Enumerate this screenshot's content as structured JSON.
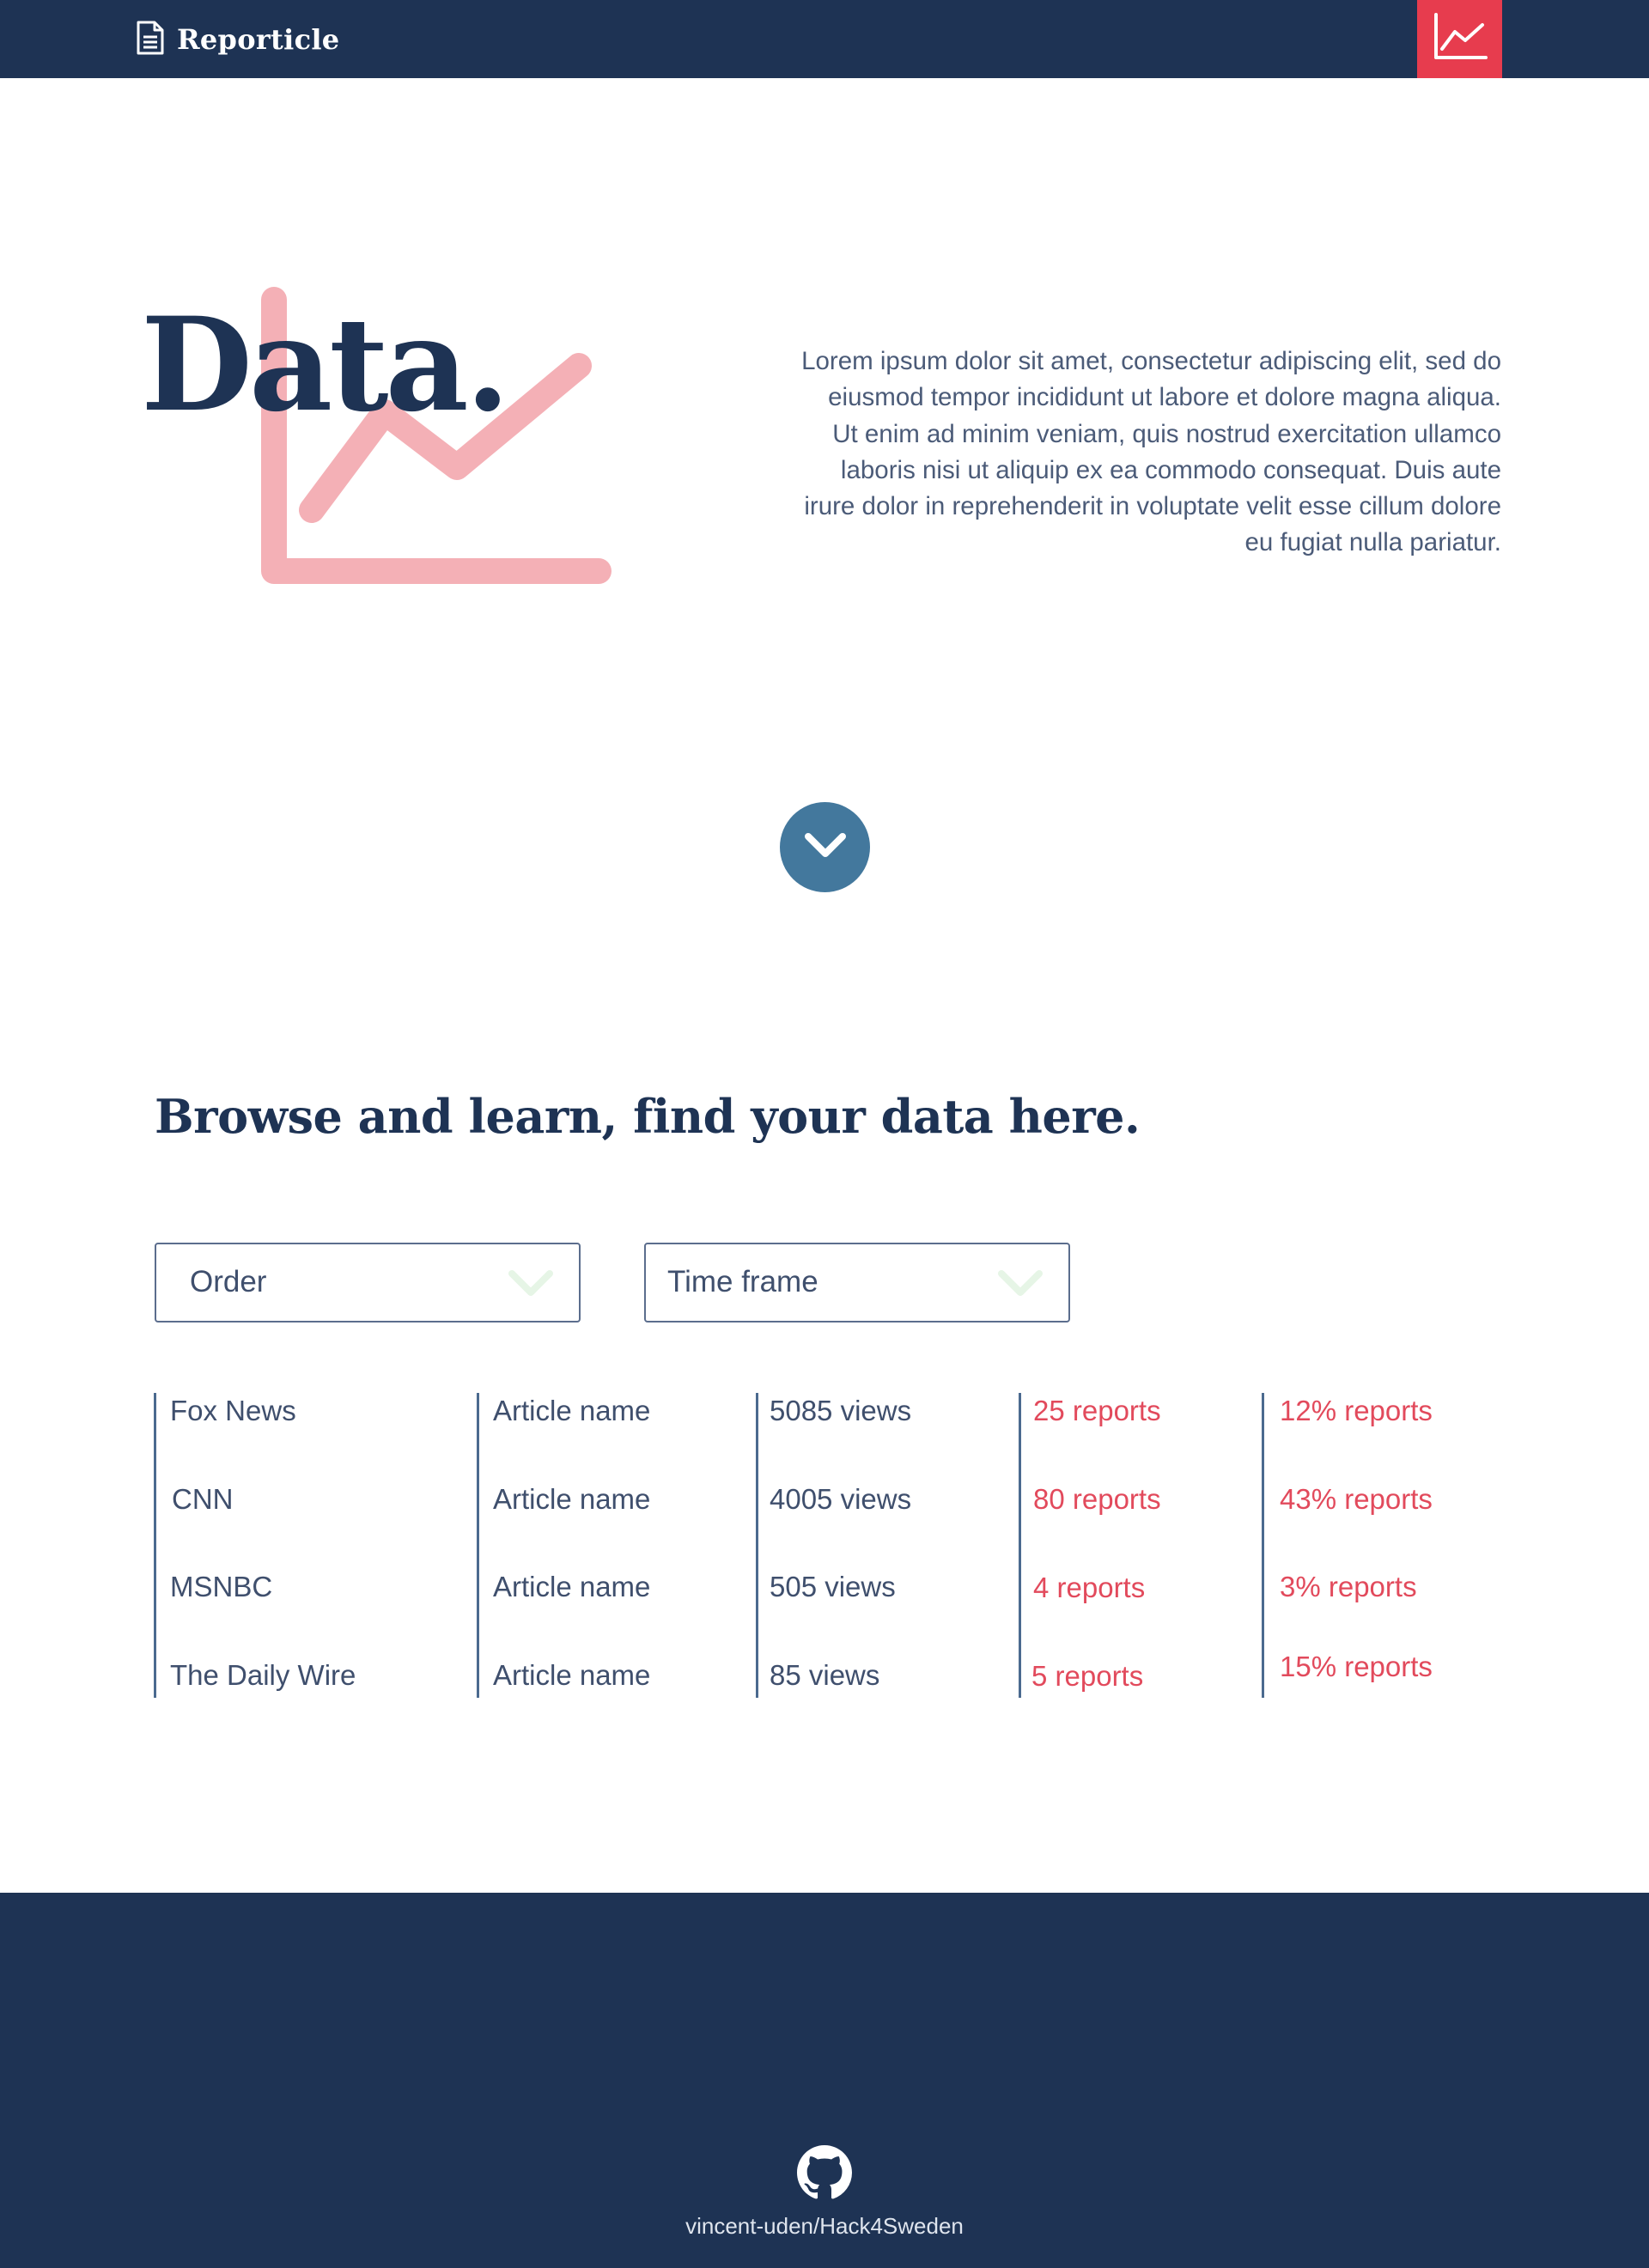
{
  "header": {
    "brand_name": "Reporticle",
    "brand_icon": "document-icon",
    "chart_button_icon": "line-chart-icon"
  },
  "hero": {
    "title": "Data.",
    "graphic_icon": "line-chart-icon",
    "text": "Lorem ipsum dolor sit amet, consectetur adipiscing elit, sed do eiusmod tempor incididunt ut labore et dolore magna aliqua. Ut enim ad minim veniam, quis nostrud exercitation ullamco laboris nisi ut aliquip ex ea commodo consequat. Duis aute irure dolor in reprehenderit in voluptate velit esse cillum dolore eu fugiat nulla pariatur.",
    "scroll_icon": "chevron-down-icon"
  },
  "browse": {
    "title": "Browse and learn, find your data here.",
    "filters": {
      "order_label": "Order",
      "timeframe_label": "Time frame"
    },
    "rows": [
      {
        "source": "Fox News",
        "article": "Article name",
        "views": "5085 views",
        "reports": "25 reports",
        "percent": "12% reports"
      },
      {
        "source": "CNN",
        "article": "Article name",
        "views": "4005 views",
        "reports": "80 reports",
        "percent": "43% reports"
      },
      {
        "source": "MSNBC",
        "article": "Article name",
        "views": "505 views",
        "reports": "4 reports",
        "percent": "3% reports"
      },
      {
        "source": "The Daily Wire",
        "article": "Article name",
        "views": "85 views",
        "reports": "5 reports",
        "percent": "15% reports"
      }
    ]
  },
  "footer": {
    "github_icon": "github-icon",
    "repo_link": "vincent-uden/Hack4Sweden"
  },
  "colors": {
    "navy": "#1e3354",
    "accent_red": "#e73c4e",
    "pink": "#f4b0b6",
    "steel_blue": "#43789d"
  }
}
